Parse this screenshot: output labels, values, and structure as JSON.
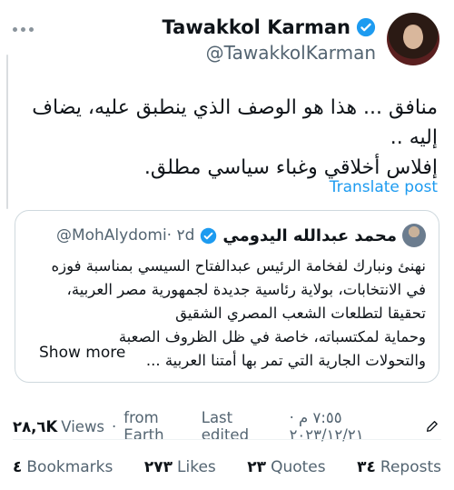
{
  "author": {
    "display_name": "Tawakkol Karman",
    "handle": "@TawakkolKarman",
    "verified": true
  },
  "tweet": {
    "text_line1": "منافق ... هذا هو الوصف الذي ينطبق عليه، يضاف إليه ..",
    "text_line2": "إفلاس أخلاقي وغباء سياسي مطلق.",
    "translate_label": "Translate post"
  },
  "quoted_tweet": {
    "display_name": "محمد عبدالله اليدومي",
    "handle": "@MohAlydomi",
    "time": "· ٢d",
    "verified": true,
    "lines": [
      "نهنئ ونبارك لفخامة الرئيس عبدالفتاح السيسي بمناسبة فوزه",
      "في الانتخابات، بولاية رئاسية جديدة لجمهورية مصر العربية،",
      "تحقيقا لتطلعات الشعب المصري الشقيق",
      "وحماية لمكتسباته، خاصة في ظل الظروف الصعبة",
      "والتحولات الجارية التي تمر بها أمتنا العربية ..."
    ],
    "show_more": "Show more"
  },
  "meta": {
    "views_count": "٢٨,٦K",
    "views_label": "Views",
    "source": "from Earth",
    "last_edited": "Last edited",
    "timestamp": "٧:٥٥ م · ٢٠٢٣/١٢/٢١"
  },
  "stats": {
    "bookmarks_count": "٤",
    "bookmarks_label": "Bookmarks",
    "likes_count": "٢٧٣",
    "likes_label": "Likes",
    "quotes_count": "٢٣",
    "quotes_label": "Quotes",
    "reposts_count": "٣٤",
    "reposts_label": "Reposts"
  },
  "colors": {
    "accent": "#1d9bf0",
    "text": "#0f1419",
    "muted": "#536471",
    "border": "#cfd9de"
  }
}
